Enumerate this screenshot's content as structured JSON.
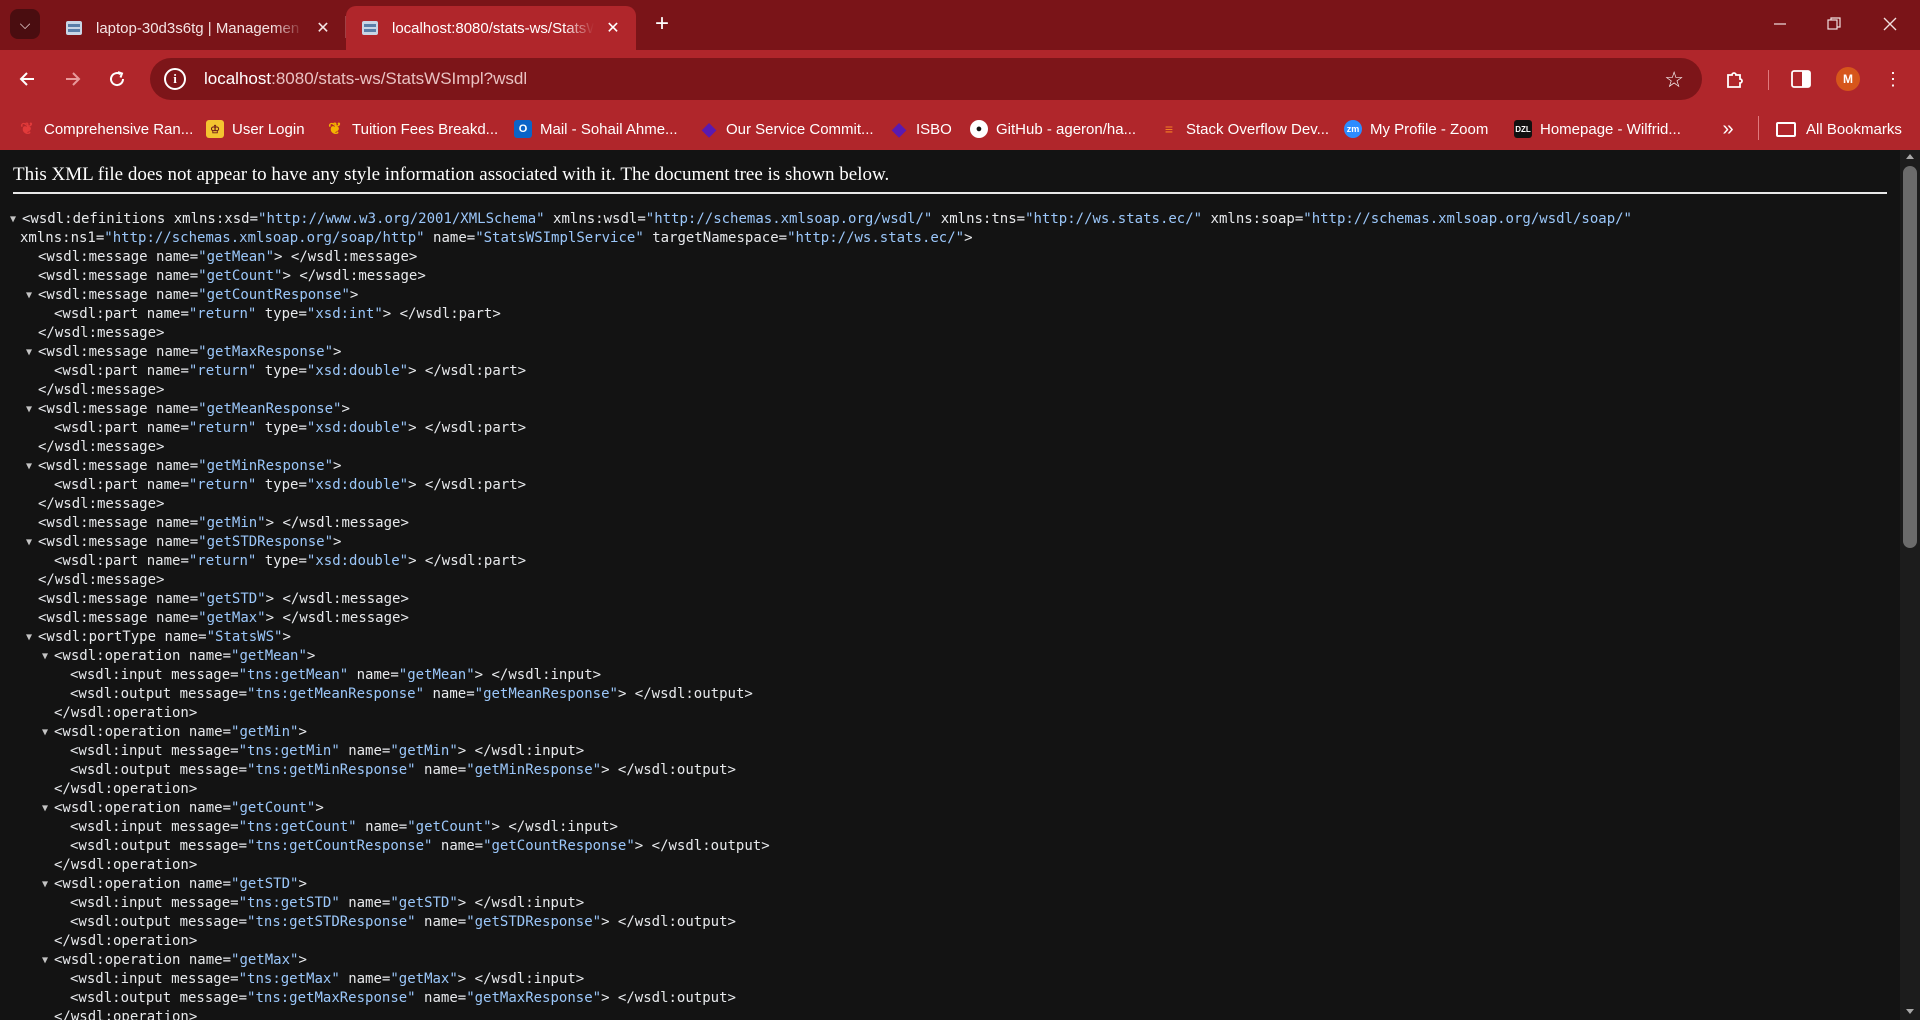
{
  "colors": {
    "titlebar": "#7a1418",
    "toolbar": "#b0262b",
    "omnibox": "#7d1519",
    "page_bg": "#131313",
    "attr_value": "#9bc7fa",
    "avatar": "#d6561b"
  },
  "tabs": [
    {
      "title": "laptop-30d3s6tg | Managemen",
      "favicon": "server-icon",
      "active": false
    },
    {
      "title": "localhost:8080/stats-ws/StatsW",
      "favicon": "server-icon",
      "active": true
    }
  ],
  "address_bar": {
    "host": "localhost",
    "path": ":8080/stats-ws/StatsWSImpl?wsdl"
  },
  "profile": {
    "initial": "M"
  },
  "bookmarks": [
    {
      "label": "Comprehensive Ran...",
      "icon": "maple-leaf-icon"
    },
    {
      "label": "User Login",
      "icon": "crest-icon"
    },
    {
      "label": "Tuition Fees Breakd...",
      "icon": "maple-leaf-icon"
    },
    {
      "label": "Mail - Sohail Ahme...",
      "icon": "outlook-icon"
    },
    {
      "label": "Our Service Commit...",
      "icon": "diamond-icon"
    },
    {
      "label": "ISBO",
      "icon": "diamond-icon"
    },
    {
      "label": "GitHub - ageron/ha...",
      "icon": "github-icon"
    },
    {
      "label": "Stack Overflow Dev...",
      "icon": "stackoverflow-icon"
    },
    {
      "label": "My Profile - Zoom",
      "icon": "zoom-icon"
    },
    {
      "label": "Homepage - Wilfrid...",
      "icon": "dzl-icon"
    }
  ],
  "all_bookmarks_label": "All Bookmarks",
  "xml_notice": "This XML file does not appear to have any style information associated with it. The document tree is shown below.",
  "xml_lines": [
    {
      "toggle": true,
      "indent": 0,
      "parts": [
        [
          "t",
          "<wsdl:definitions "
        ],
        [
          "a",
          "xmlns:xsd"
        ],
        [
          "t",
          "="
        ],
        [
          "v",
          "\"http://www.w3.org/2001/XMLSchema\""
        ],
        [
          "t",
          " "
        ],
        [
          "a",
          "xmlns:wsdl"
        ],
        [
          "t",
          "="
        ],
        [
          "v",
          "\"http://schemas.xmlsoap.org/wsdl/\""
        ],
        [
          "t",
          " "
        ],
        [
          "a",
          "xmlns:tns"
        ],
        [
          "t",
          "="
        ],
        [
          "v",
          "\"http://ws.stats.ec/\""
        ],
        [
          "t",
          " "
        ],
        [
          "a",
          "xmlns:soap"
        ],
        [
          "t",
          "="
        ],
        [
          "v",
          "\"http://schemas.xmlsoap.org/wsdl/soap/\""
        ]
      ]
    },
    {
      "toggle": false,
      "indent": 0,
      "parts": [
        [
          "a",
          "xmlns:ns1"
        ],
        [
          "t",
          "="
        ],
        [
          "v",
          "\"http://schemas.xmlsoap.org/soap/http\""
        ],
        [
          "t",
          " "
        ],
        [
          "a",
          "name"
        ],
        [
          "t",
          "="
        ],
        [
          "v",
          "\"StatsWSImplService\""
        ],
        [
          "t",
          " "
        ],
        [
          "a",
          "targetNamespace"
        ],
        [
          "t",
          "="
        ],
        [
          "v",
          "\"http://ws.stats.ec/\""
        ],
        [
          "t",
          ">"
        ]
      ]
    },
    {
      "toggle": false,
      "indent": 1,
      "parts": [
        [
          "t",
          "<wsdl:message "
        ],
        [
          "a",
          "name"
        ],
        [
          "t",
          "="
        ],
        [
          "v",
          "\"getMean\""
        ],
        [
          "t",
          "> </wsdl:message>"
        ]
      ]
    },
    {
      "toggle": false,
      "indent": 1,
      "parts": [
        [
          "t",
          "<wsdl:message "
        ],
        [
          "a",
          "name"
        ],
        [
          "t",
          "="
        ],
        [
          "v",
          "\"getCount\""
        ],
        [
          "t",
          "> </wsdl:message>"
        ]
      ]
    },
    {
      "toggle": true,
      "indent": 1,
      "parts": [
        [
          "t",
          "<wsdl:message "
        ],
        [
          "a",
          "name"
        ],
        [
          "t",
          "="
        ],
        [
          "v",
          "\"getCountResponse\""
        ],
        [
          "t",
          ">"
        ]
      ]
    },
    {
      "toggle": false,
      "indent": 2,
      "parts": [
        [
          "t",
          "<wsdl:part "
        ],
        [
          "a",
          "name"
        ],
        [
          "t",
          "="
        ],
        [
          "v",
          "\"return\""
        ],
        [
          "t",
          " "
        ],
        [
          "a",
          "type"
        ],
        [
          "t",
          "="
        ],
        [
          "v",
          "\"xsd:int\""
        ],
        [
          "t",
          "> </wsdl:part>"
        ]
      ]
    },
    {
      "toggle": false,
      "indent": 1,
      "parts": [
        [
          "t",
          "</wsdl:message>"
        ]
      ]
    },
    {
      "toggle": true,
      "indent": 1,
      "parts": [
        [
          "t",
          "<wsdl:message "
        ],
        [
          "a",
          "name"
        ],
        [
          "t",
          "="
        ],
        [
          "v",
          "\"getMaxResponse\""
        ],
        [
          "t",
          ">"
        ]
      ]
    },
    {
      "toggle": false,
      "indent": 2,
      "parts": [
        [
          "t",
          "<wsdl:part "
        ],
        [
          "a",
          "name"
        ],
        [
          "t",
          "="
        ],
        [
          "v",
          "\"return\""
        ],
        [
          "t",
          " "
        ],
        [
          "a",
          "type"
        ],
        [
          "t",
          "="
        ],
        [
          "v",
          "\"xsd:double\""
        ],
        [
          "t",
          "> </wsdl:part>"
        ]
      ]
    },
    {
      "toggle": false,
      "indent": 1,
      "parts": [
        [
          "t",
          "</wsdl:message>"
        ]
      ]
    },
    {
      "toggle": true,
      "indent": 1,
      "parts": [
        [
          "t",
          "<wsdl:message "
        ],
        [
          "a",
          "name"
        ],
        [
          "t",
          "="
        ],
        [
          "v",
          "\"getMeanResponse\""
        ],
        [
          "t",
          ">"
        ]
      ]
    },
    {
      "toggle": false,
      "indent": 2,
      "parts": [
        [
          "t",
          "<wsdl:part "
        ],
        [
          "a",
          "name"
        ],
        [
          "t",
          "="
        ],
        [
          "v",
          "\"return\""
        ],
        [
          "t",
          " "
        ],
        [
          "a",
          "type"
        ],
        [
          "t",
          "="
        ],
        [
          "v",
          "\"xsd:double\""
        ],
        [
          "t",
          "> </wsdl:part>"
        ]
      ]
    },
    {
      "toggle": false,
      "indent": 1,
      "parts": [
        [
          "t",
          "</wsdl:message>"
        ]
      ]
    },
    {
      "toggle": true,
      "indent": 1,
      "parts": [
        [
          "t",
          "<wsdl:message "
        ],
        [
          "a",
          "name"
        ],
        [
          "t",
          "="
        ],
        [
          "v",
          "\"getMinResponse\""
        ],
        [
          "t",
          ">"
        ]
      ]
    },
    {
      "toggle": false,
      "indent": 2,
      "parts": [
        [
          "t",
          "<wsdl:part "
        ],
        [
          "a",
          "name"
        ],
        [
          "t",
          "="
        ],
        [
          "v",
          "\"return\""
        ],
        [
          "t",
          " "
        ],
        [
          "a",
          "type"
        ],
        [
          "t",
          "="
        ],
        [
          "v",
          "\"xsd:double\""
        ],
        [
          "t",
          "> </wsdl:part>"
        ]
      ]
    },
    {
      "toggle": false,
      "indent": 1,
      "parts": [
        [
          "t",
          "</wsdl:message>"
        ]
      ]
    },
    {
      "toggle": false,
      "indent": 1,
      "parts": [
        [
          "t",
          "<wsdl:message "
        ],
        [
          "a",
          "name"
        ],
        [
          "t",
          "="
        ],
        [
          "v",
          "\"getMin\""
        ],
        [
          "t",
          "> </wsdl:message>"
        ]
      ]
    },
    {
      "toggle": true,
      "indent": 1,
      "parts": [
        [
          "t",
          "<wsdl:message "
        ],
        [
          "a",
          "name"
        ],
        [
          "t",
          "="
        ],
        [
          "v",
          "\"getSTDResponse\""
        ],
        [
          "t",
          ">"
        ]
      ]
    },
    {
      "toggle": false,
      "indent": 2,
      "parts": [
        [
          "t",
          "<wsdl:part "
        ],
        [
          "a",
          "name"
        ],
        [
          "t",
          "="
        ],
        [
          "v",
          "\"return\""
        ],
        [
          "t",
          " "
        ],
        [
          "a",
          "type"
        ],
        [
          "t",
          "="
        ],
        [
          "v",
          "\"xsd:double\""
        ],
        [
          "t",
          "> </wsdl:part>"
        ]
      ]
    },
    {
      "toggle": false,
      "indent": 1,
      "parts": [
        [
          "t",
          "</wsdl:message>"
        ]
      ]
    },
    {
      "toggle": false,
      "indent": 1,
      "parts": [
        [
          "t",
          "<wsdl:message "
        ],
        [
          "a",
          "name"
        ],
        [
          "t",
          "="
        ],
        [
          "v",
          "\"getSTD\""
        ],
        [
          "t",
          "> </wsdl:message>"
        ]
      ]
    },
    {
      "toggle": false,
      "indent": 1,
      "parts": [
        [
          "t",
          "<wsdl:message "
        ],
        [
          "a",
          "name"
        ],
        [
          "t",
          "="
        ],
        [
          "v",
          "\"getMax\""
        ],
        [
          "t",
          "> </wsdl:message>"
        ]
      ]
    },
    {
      "toggle": true,
      "indent": 1,
      "parts": [
        [
          "t",
          "<wsdl:portType "
        ],
        [
          "a",
          "name"
        ],
        [
          "t",
          "="
        ],
        [
          "v",
          "\"StatsWS\""
        ],
        [
          "t",
          ">"
        ]
      ]
    },
    {
      "toggle": true,
      "indent": 2,
      "parts": [
        [
          "t",
          "<wsdl:operation "
        ],
        [
          "a",
          "name"
        ],
        [
          "t",
          "="
        ],
        [
          "v",
          "\"getMean\""
        ],
        [
          "t",
          ">"
        ]
      ]
    },
    {
      "toggle": false,
      "indent": 3,
      "parts": [
        [
          "t",
          "<wsdl:input "
        ],
        [
          "a",
          "message"
        ],
        [
          "t",
          "="
        ],
        [
          "v",
          "\"tns:getMean\""
        ],
        [
          "t",
          " "
        ],
        [
          "a",
          "name"
        ],
        [
          "t",
          "="
        ],
        [
          "v",
          "\"getMean\""
        ],
        [
          "t",
          "> </wsdl:input>"
        ]
      ]
    },
    {
      "toggle": false,
      "indent": 3,
      "parts": [
        [
          "t",
          "<wsdl:output "
        ],
        [
          "a",
          "message"
        ],
        [
          "t",
          "="
        ],
        [
          "v",
          "\"tns:getMeanResponse\""
        ],
        [
          "t",
          " "
        ],
        [
          "a",
          "name"
        ],
        [
          "t",
          "="
        ],
        [
          "v",
          "\"getMeanResponse\""
        ],
        [
          "t",
          "> </wsdl:output>"
        ]
      ]
    },
    {
      "toggle": false,
      "indent": 2,
      "parts": [
        [
          "t",
          "</wsdl:operation>"
        ]
      ]
    },
    {
      "toggle": true,
      "indent": 2,
      "parts": [
        [
          "t",
          "<wsdl:operation "
        ],
        [
          "a",
          "name"
        ],
        [
          "t",
          "="
        ],
        [
          "v",
          "\"getMin\""
        ],
        [
          "t",
          ">"
        ]
      ]
    },
    {
      "toggle": false,
      "indent": 3,
      "parts": [
        [
          "t",
          "<wsdl:input "
        ],
        [
          "a",
          "message"
        ],
        [
          "t",
          "="
        ],
        [
          "v",
          "\"tns:getMin\""
        ],
        [
          "t",
          " "
        ],
        [
          "a",
          "name"
        ],
        [
          "t",
          "="
        ],
        [
          "v",
          "\"getMin\""
        ],
        [
          "t",
          "> </wsdl:input>"
        ]
      ]
    },
    {
      "toggle": false,
      "indent": 3,
      "parts": [
        [
          "t",
          "<wsdl:output "
        ],
        [
          "a",
          "message"
        ],
        [
          "t",
          "="
        ],
        [
          "v",
          "\"tns:getMinResponse\""
        ],
        [
          "t",
          " "
        ],
        [
          "a",
          "name"
        ],
        [
          "t",
          "="
        ],
        [
          "v",
          "\"getMinResponse\""
        ],
        [
          "t",
          "> </wsdl:output>"
        ]
      ]
    },
    {
      "toggle": false,
      "indent": 2,
      "parts": [
        [
          "t",
          "</wsdl:operation>"
        ]
      ]
    },
    {
      "toggle": true,
      "indent": 2,
      "parts": [
        [
          "t",
          "<wsdl:operation "
        ],
        [
          "a",
          "name"
        ],
        [
          "t",
          "="
        ],
        [
          "v",
          "\"getCount\""
        ],
        [
          "t",
          ">"
        ]
      ]
    },
    {
      "toggle": false,
      "indent": 3,
      "parts": [
        [
          "t",
          "<wsdl:input "
        ],
        [
          "a",
          "message"
        ],
        [
          "t",
          "="
        ],
        [
          "v",
          "\"tns:getCount\""
        ],
        [
          "t",
          " "
        ],
        [
          "a",
          "name"
        ],
        [
          "t",
          "="
        ],
        [
          "v",
          "\"getCount\""
        ],
        [
          "t",
          "> </wsdl:input>"
        ]
      ]
    },
    {
      "toggle": false,
      "indent": 3,
      "parts": [
        [
          "t",
          "<wsdl:output "
        ],
        [
          "a",
          "message"
        ],
        [
          "t",
          "="
        ],
        [
          "v",
          "\"tns:getCountResponse\""
        ],
        [
          "t",
          " "
        ],
        [
          "a",
          "name"
        ],
        [
          "t",
          "="
        ],
        [
          "v",
          "\"getCountResponse\""
        ],
        [
          "t",
          "> </wsdl:output>"
        ]
      ]
    },
    {
      "toggle": false,
      "indent": 2,
      "parts": [
        [
          "t",
          "</wsdl:operation>"
        ]
      ]
    },
    {
      "toggle": true,
      "indent": 2,
      "parts": [
        [
          "t",
          "<wsdl:operation "
        ],
        [
          "a",
          "name"
        ],
        [
          "t",
          "="
        ],
        [
          "v",
          "\"getSTD\""
        ],
        [
          "t",
          ">"
        ]
      ]
    },
    {
      "toggle": false,
      "indent": 3,
      "parts": [
        [
          "t",
          "<wsdl:input "
        ],
        [
          "a",
          "message"
        ],
        [
          "t",
          "="
        ],
        [
          "v",
          "\"tns:getSTD\""
        ],
        [
          "t",
          " "
        ],
        [
          "a",
          "name"
        ],
        [
          "t",
          "="
        ],
        [
          "v",
          "\"getSTD\""
        ],
        [
          "t",
          "> </wsdl:input>"
        ]
      ]
    },
    {
      "toggle": false,
      "indent": 3,
      "parts": [
        [
          "t",
          "<wsdl:output "
        ],
        [
          "a",
          "message"
        ],
        [
          "t",
          "="
        ],
        [
          "v",
          "\"tns:getSTDResponse\""
        ],
        [
          "t",
          " "
        ],
        [
          "a",
          "name"
        ],
        [
          "t",
          "="
        ],
        [
          "v",
          "\"getSTDResponse\""
        ],
        [
          "t",
          "> </wsdl:output>"
        ]
      ]
    },
    {
      "toggle": false,
      "indent": 2,
      "parts": [
        [
          "t",
          "</wsdl:operation>"
        ]
      ]
    },
    {
      "toggle": true,
      "indent": 2,
      "parts": [
        [
          "t",
          "<wsdl:operation "
        ],
        [
          "a",
          "name"
        ],
        [
          "t",
          "="
        ],
        [
          "v",
          "\"getMax\""
        ],
        [
          "t",
          ">"
        ]
      ]
    },
    {
      "toggle": false,
      "indent": 3,
      "parts": [
        [
          "t",
          "<wsdl:input "
        ],
        [
          "a",
          "message"
        ],
        [
          "t",
          "="
        ],
        [
          "v",
          "\"tns:getMax\""
        ],
        [
          "t",
          " "
        ],
        [
          "a",
          "name"
        ],
        [
          "t",
          "="
        ],
        [
          "v",
          "\"getMax\""
        ],
        [
          "t",
          "> </wsdl:input>"
        ]
      ]
    },
    {
      "toggle": false,
      "indent": 3,
      "parts": [
        [
          "t",
          "<wsdl:output "
        ],
        [
          "a",
          "message"
        ],
        [
          "t",
          "="
        ],
        [
          "v",
          "\"tns:getMaxResponse\""
        ],
        [
          "t",
          " "
        ],
        [
          "a",
          "name"
        ],
        [
          "t",
          "="
        ],
        [
          "v",
          "\"getMaxResponse\""
        ],
        [
          "t",
          "> </wsdl:output>"
        ]
      ]
    },
    {
      "toggle": false,
      "indent": 2,
      "parts": [
        [
          "t",
          "</wsdl:operation>"
        ]
      ]
    }
  ]
}
